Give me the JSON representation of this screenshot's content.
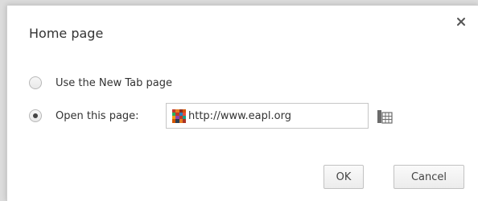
{
  "dialog": {
    "title": "Home page",
    "close_icon": "close-icon"
  },
  "options": [
    {
      "label": "Use the New Tab page",
      "selected": false
    },
    {
      "label": "Open this page:",
      "selected": true
    }
  ],
  "url_field": {
    "value": "http://www.eapl.org",
    "favicon": "site-favicon-icon"
  },
  "page_picker_icon": "page-picker-icon",
  "buttons": {
    "ok": "OK",
    "cancel": "Cancel"
  },
  "colors": {
    "dialog_bg": "#ffffff",
    "text": "#333333",
    "radio_dot": "#444444"
  }
}
